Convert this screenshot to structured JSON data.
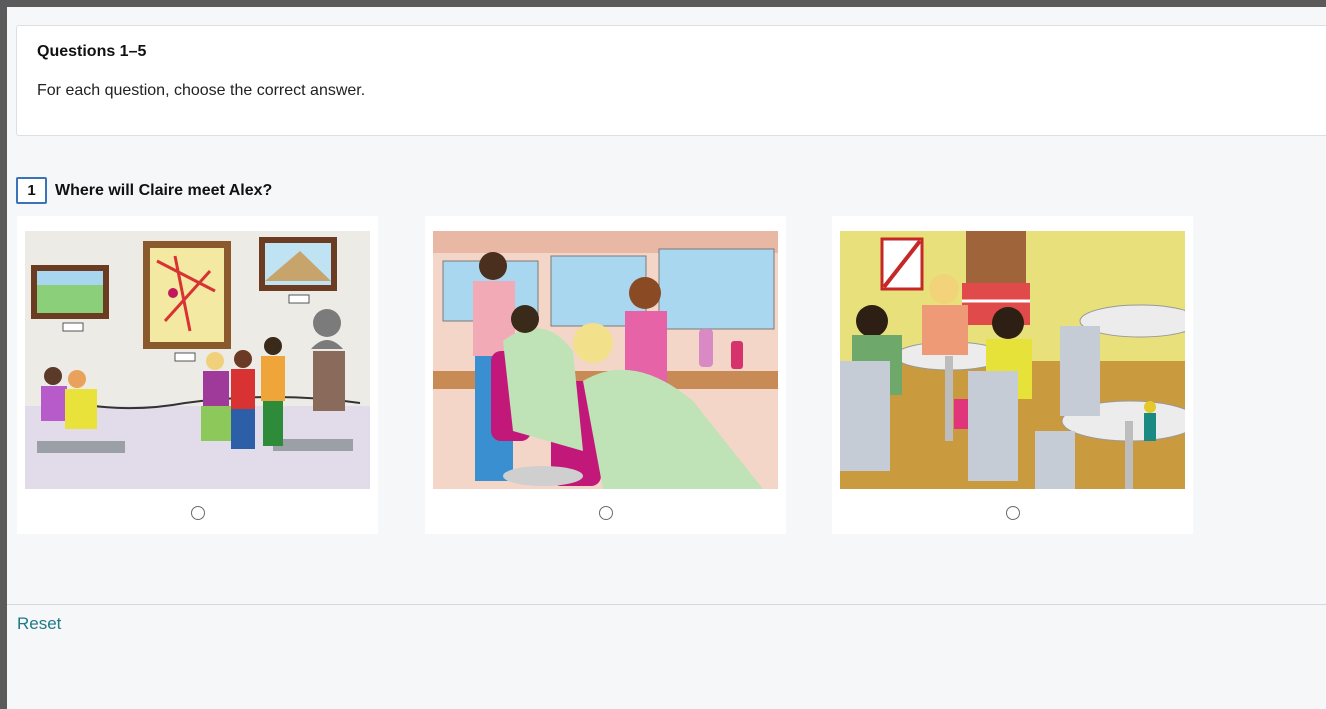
{
  "instructions": {
    "title": "Questions 1–5",
    "text": "For each question, choose the correct answer."
  },
  "question": {
    "number": "1",
    "text": "Where will Claire meet Alex?"
  },
  "options": [
    {
      "scene": "art-gallery",
      "selected": false
    },
    {
      "scene": "hair-salon",
      "selected": false
    },
    {
      "scene": "cafe",
      "selected": false
    }
  ],
  "footer": {
    "reset_label": "Reset"
  },
  "colors": {
    "accent": "#3a73b8",
    "link": "#1e7a86",
    "background": "#f6f7f9"
  }
}
